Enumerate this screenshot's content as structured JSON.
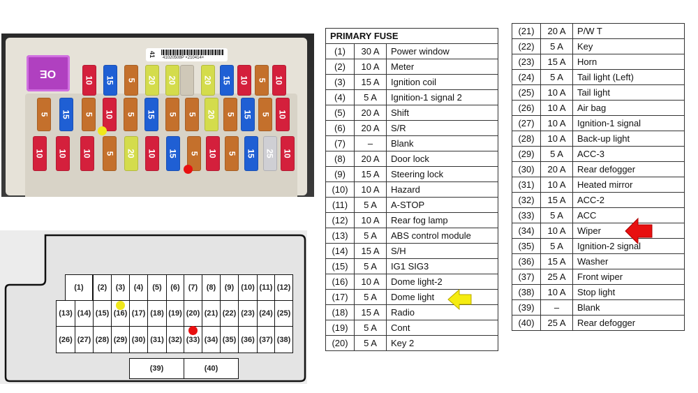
{
  "photo": {
    "main_fuse_label": "OE",
    "barcode_prefix": "41",
    "barcode_text": "41020508P  ×210414×",
    "fuse_colors": {
      "5": "#c4702c",
      "10": "#d4203c",
      "15": "#1f5fd4",
      "20": "#d4dc4c",
      "25": "#cfcfd4"
    },
    "rows": [
      [
        "10",
        "15",
        "5",
        "20",
        "20",
        "",
        "20",
        "15",
        "10",
        "5",
        "10"
      ],
      [
        "5",
        "15",
        "5",
        "10",
        "5",
        "15",
        "5",
        "5",
        "20",
        "5",
        "15",
        "5",
        "10"
      ],
      [
        "10",
        "10",
        "10",
        "5",
        "20",
        "10",
        "15",
        "5",
        "10",
        "5",
        "15",
        "25",
        "10"
      ]
    ],
    "markers": [
      {
        "color": "#f0e81c"
      },
      {
        "color": "#e81010"
      }
    ]
  },
  "diagram": {
    "row1": [
      "(1)",
      "(2)",
      "(3)",
      "(4)",
      "(5)",
      "(6)",
      "(7)",
      "(8)",
      "(9)",
      "(10)",
      "(11)",
      "(12)"
    ],
    "row2": [
      "(13)",
      "(14)",
      "(15)",
      "(16)",
      "(17)",
      "(18)",
      "(19)",
      "(20)",
      "(21)",
      "(22)",
      "(23)",
      "(24)",
      "(25)"
    ],
    "row3": [
      "(26)",
      "(27)",
      "(28)",
      "(29)",
      "(30)",
      "(31)",
      "(32)",
      "(33)",
      "(34)",
      "(35)",
      "(36)",
      "(37)",
      "(38)"
    ],
    "row4": [
      "(39)",
      "(40)"
    ],
    "highlight_yellow": "(16)",
    "highlight_red": "(33)"
  },
  "table_left": {
    "title": "PRIMARY FUSE",
    "rows": [
      [
        "(1)",
        "30 A",
        "Power window"
      ],
      [
        "(2)",
        "10 A",
        "Meter"
      ],
      [
        "(3)",
        "15 A",
        "Ignition coil"
      ],
      [
        "(4)",
        "5 A",
        "Ignition-1 signal 2"
      ],
      [
        "(5)",
        "20 A",
        "Shift"
      ],
      [
        "(6)",
        "20 A",
        "S/R"
      ],
      [
        "(7)",
        "–",
        "Blank"
      ],
      [
        "(8)",
        "20 A",
        "Door lock"
      ],
      [
        "(9)",
        "15 A",
        "Steering lock"
      ],
      [
        "(10)",
        "10 A",
        "Hazard"
      ],
      [
        "(11)",
        "5 A",
        "A-STOP"
      ],
      [
        "(12)",
        "10 A",
        "Rear fog lamp"
      ],
      [
        "(13)",
        "5 A",
        "ABS control module"
      ],
      [
        "(14)",
        "15 A",
        "S/H"
      ],
      [
        "(15)",
        "5 A",
        "IG1 SIG3"
      ],
      [
        "(16)",
        "10 A",
        "Dome light-2"
      ],
      [
        "(17)",
        "5 A",
        "Dome light"
      ],
      [
        "(18)",
        "15 A",
        "Radio"
      ],
      [
        "(19)",
        "5 A",
        "Cont"
      ],
      [
        "(20)",
        "5 A",
        "Key 2"
      ]
    ]
  },
  "table_right": {
    "rows": [
      [
        "(21)",
        "20 A",
        "P/W T"
      ],
      [
        "(22)",
        "5 A",
        "Key"
      ],
      [
        "(23)",
        "15 A",
        "Horn"
      ],
      [
        "(24)",
        "5 A",
        "Tail light (Left)"
      ],
      [
        "(25)",
        "10 A",
        "Tail light"
      ],
      [
        "(26)",
        "10 A",
        "Air bag"
      ],
      [
        "(27)",
        "10 A",
        "Ignition-1 signal"
      ],
      [
        "(28)",
        "10 A",
        "Back-up light"
      ],
      [
        "(29)",
        "5 A",
        "ACC-3"
      ],
      [
        "(30)",
        "20 A",
        "Rear defogger"
      ],
      [
        "(31)",
        "10 A",
        "Heated mirror"
      ],
      [
        "(32)",
        "15 A",
        "ACC-2"
      ],
      [
        "(33)",
        "5 A",
        "ACC"
      ],
      [
        "(34)",
        "10 A",
        "Wiper"
      ],
      [
        "(35)",
        "5 A",
        "Ignition-2 signal"
      ],
      [
        "(36)",
        "15 A",
        "Washer"
      ],
      [
        "(37)",
        "25 A",
        "Front wiper"
      ],
      [
        "(38)",
        "10 A",
        "Stop light"
      ],
      [
        "(39)",
        "–",
        "Blank"
      ],
      [
        "(40)",
        "25 A",
        "Rear defogger"
      ]
    ]
  },
  "arrows": {
    "yellow": "#f5ec10",
    "red": "#e81010"
  }
}
